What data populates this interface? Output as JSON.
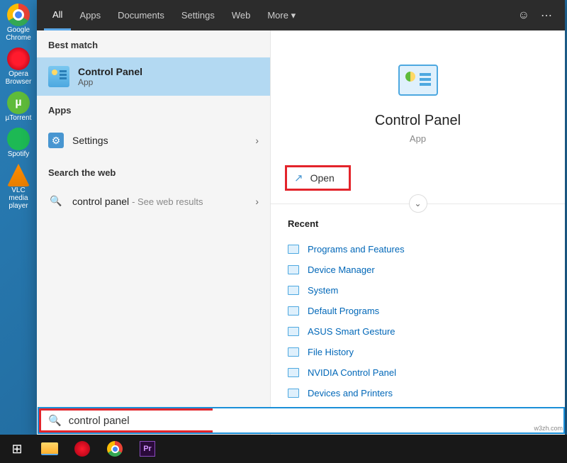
{
  "desktop": {
    "icons": [
      {
        "label": "Google Chrome",
        "class": "chrome"
      },
      {
        "label": "Opera Browser",
        "class": "opera"
      },
      {
        "label": "µTorrent",
        "class": "utorr",
        "glyph": "µ"
      },
      {
        "label": "Spotify",
        "class": "spot"
      },
      {
        "label": "VLC media player",
        "class": "vlc"
      }
    ]
  },
  "tabs": {
    "items": [
      "All",
      "Apps",
      "Documents",
      "Settings",
      "Web",
      "More"
    ],
    "active": 0,
    "more_glyph": "▾"
  },
  "left": {
    "best_match_header": "Best match",
    "best": {
      "title": "Control Panel",
      "subtitle": "App"
    },
    "apps_header": "Apps",
    "settings_label": "Settings",
    "search_web_header": "Search the web",
    "web_row": {
      "query": "control panel",
      "hint": "- See web results"
    }
  },
  "right": {
    "title": "Control Panel",
    "subtitle": "App",
    "open_label": "Open",
    "recent_header": "Recent",
    "recent": [
      "Programs and Features",
      "Device Manager",
      "System",
      "Default Programs",
      "ASUS Smart Gesture",
      "File History",
      "NVIDIA Control Panel",
      "Devices and Printers"
    ]
  },
  "search": {
    "value": "control panel"
  },
  "watermark": "w3zh.com"
}
